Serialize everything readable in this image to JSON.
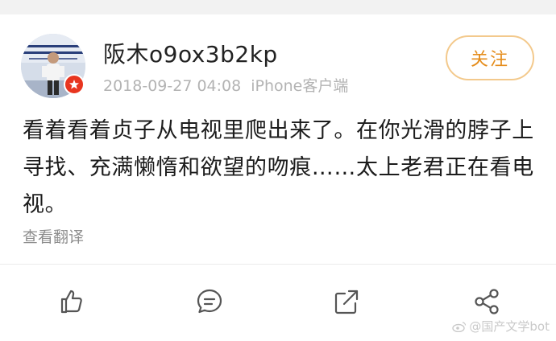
{
  "post": {
    "username": "阪木o9ox3b2kp",
    "timestamp": "2018-09-27 04:08",
    "source": "iPhone客户端",
    "follow_label": "关注",
    "text": "看着看着贞子从电视里爬出来了。在你光滑的脖子上寻找、充满懒惰和欲望的吻痕……太上老君正在看电视。",
    "translate_label": "查看翻译"
  },
  "actions": {
    "like_icon": "thumbs-up-icon",
    "comment_icon": "comment-bubble-icon",
    "repost_icon": "repost-arrow-icon",
    "share_icon": "share-nodes-icon"
  },
  "watermark": {
    "text": "@国产文学bot"
  },
  "colors": {
    "follow_border": "#f3c98c",
    "follow_text": "#e58d1c",
    "badge": "#e8351f",
    "meta_text": "#b3b3b3",
    "body_text": "#1c1c1c"
  }
}
